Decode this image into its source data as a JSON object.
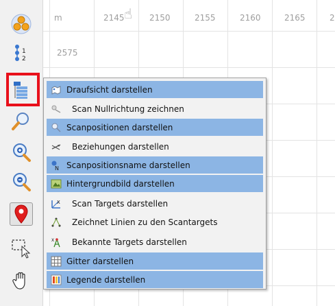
{
  "canvas": {
    "x_axis_unit": "m",
    "x_labels": [
      "2145",
      "2150",
      "2155",
      "2160",
      "2165",
      "2"
    ],
    "y_label": "2575"
  },
  "toolbar": {
    "tools": [
      {
        "icon": "scan-positions-orange-icon"
      },
      {
        "icon": "numbered-sequence-icon"
      },
      {
        "icon": "tree-list-icon",
        "highlighted": true
      },
      {
        "icon": "zoom-window-icon"
      },
      {
        "icon": "zoom-in-icon"
      },
      {
        "icon": "zoom-out-icon"
      },
      {
        "icon": "location-pin-icon",
        "active": true
      },
      {
        "icon": "rectangle-select-icon"
      },
      {
        "icon": "pan-hand-icon"
      }
    ],
    "highlight_color": "#e8101b"
  },
  "menu": {
    "checked_color": "#8cb5e4",
    "items": [
      {
        "label": "Draufsicht darstellen",
        "checked": true,
        "icon": "top-view-icon"
      },
      {
        "label": "Scan Nullrichtung zeichnen",
        "checked": false,
        "icon": "scan-direction-icon"
      },
      {
        "label": "Scanpositionen darstellen",
        "checked": true,
        "icon": "scan-position-icon"
      },
      {
        "label": "Beziehungen darstellen",
        "checked": false,
        "icon": "relations-icon"
      },
      {
        "label": "Scanpositionsname darstellen",
        "checked": true,
        "icon": "scan-position-name-icon"
      },
      {
        "label": "Hintergrundbild darstellen",
        "checked": true,
        "icon": "background-image-icon"
      },
      {
        "label": "Scan Targets darstellen",
        "checked": false,
        "icon": "scan-targets-icon"
      },
      {
        "label": "Zeichnet Linien zu den Scantargets",
        "checked": false,
        "icon": "target-lines-icon"
      },
      {
        "label": "Bekannte Targets darstellen",
        "checked": false,
        "icon": "known-targets-icon"
      },
      {
        "label": "Gitter darstellen",
        "checked": true,
        "icon": "grid-icon"
      },
      {
        "label": "Legende darstellen",
        "checked": true,
        "icon": "legend-icon"
      }
    ]
  }
}
